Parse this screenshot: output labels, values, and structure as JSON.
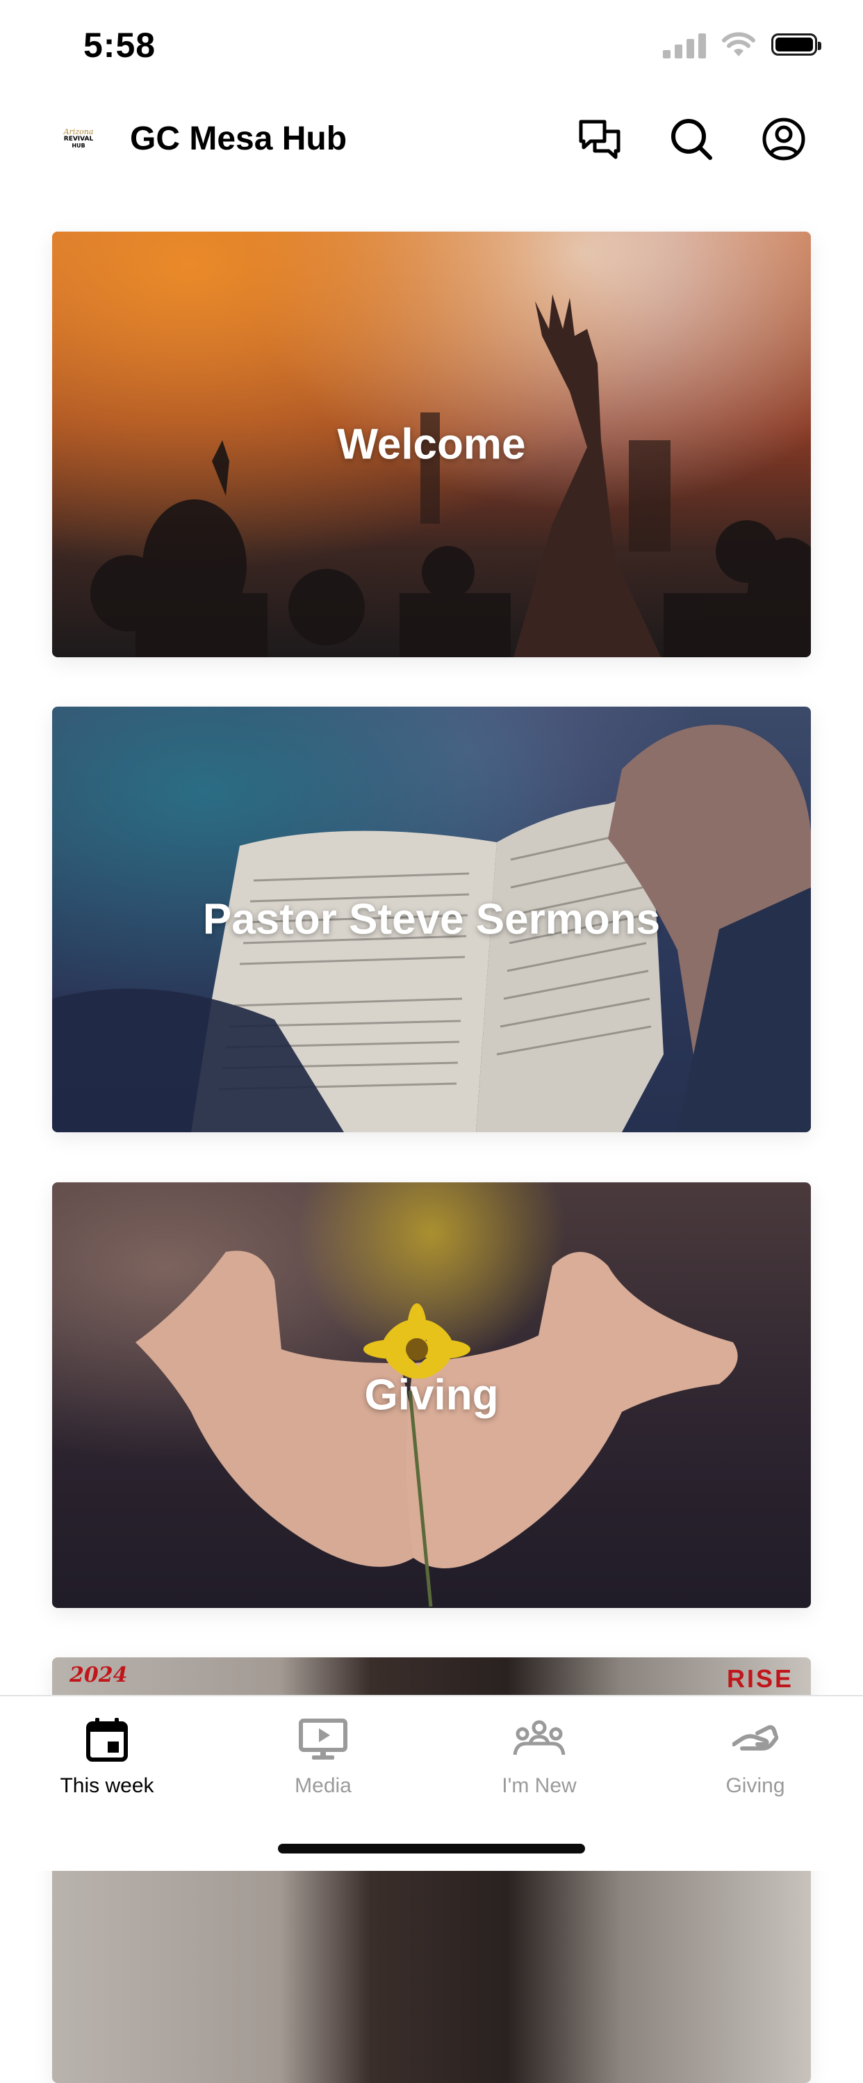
{
  "status_bar": {
    "time": "5:58"
  },
  "header": {
    "logo": {
      "line1": "Arizona",
      "line2": "REVIVAL",
      "line3": "HUB"
    },
    "title": "GC Mesa Hub",
    "icons": [
      "chat-icon",
      "search-icon",
      "profile-icon"
    ]
  },
  "cards": [
    {
      "title": "Welcome"
    },
    {
      "title": "Pastor Steve Sermons"
    },
    {
      "title": "Giving"
    },
    {
      "title": "",
      "corner_left": "2024",
      "corner_right": "RISE"
    }
  ],
  "tabs": [
    {
      "label": "This week",
      "icon": "calendar-icon",
      "active": true
    },
    {
      "label": "Media",
      "icon": "play-screen-icon",
      "active": false
    },
    {
      "label": "I'm New",
      "icon": "group-icon",
      "active": false
    },
    {
      "label": "Giving",
      "icon": "giving-hand-icon",
      "active": false
    }
  ],
  "colors": {
    "active_tab": "#000000",
    "inactive_tab": "#9a9a9a",
    "accent_red": "#c0161b"
  }
}
